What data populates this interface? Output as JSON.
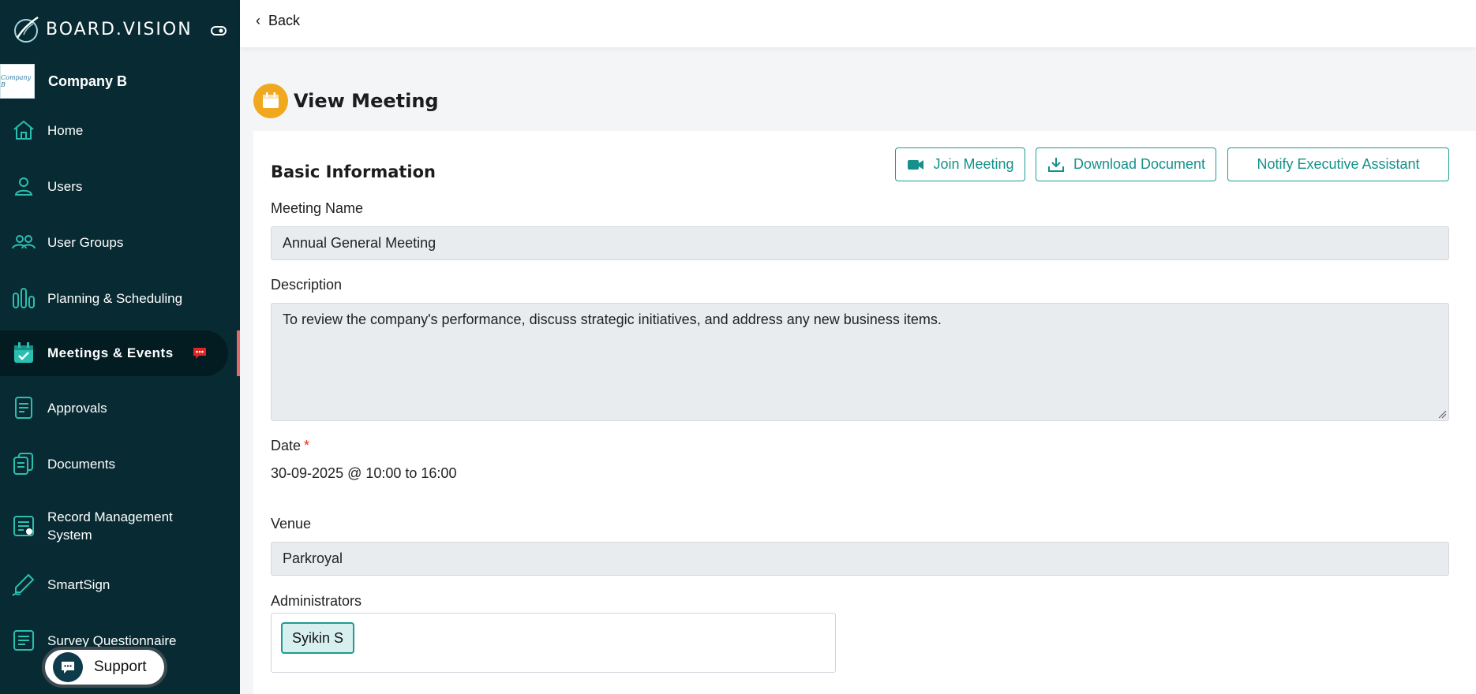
{
  "brand": {
    "name": "BOARD.VISION"
  },
  "company": {
    "name": "Company B",
    "logo_text": "Company B"
  },
  "sidebar": {
    "items": [
      {
        "label": "Home",
        "icon": "home-icon"
      },
      {
        "label": "Users",
        "icon": "user-icon"
      },
      {
        "label": "User Groups",
        "icon": "user-group-icon"
      },
      {
        "label": "Planning & Scheduling",
        "icon": "bar-chart-icon"
      },
      {
        "label": "Meetings & Events",
        "icon": "calendar-check-icon",
        "active": true
      },
      {
        "label": "Approvals",
        "icon": "approval-doc-icon"
      },
      {
        "label": "Documents",
        "icon": "documents-icon"
      },
      {
        "label": "Record Management System",
        "icon": "record-icon"
      },
      {
        "label": "SmartSign",
        "icon": "pen-icon"
      },
      {
        "label": "Survey Questionnaire",
        "icon": "survey-icon"
      }
    ]
  },
  "support": {
    "label": "Support"
  },
  "topbar": {
    "back_label": "Back"
  },
  "page": {
    "title": "View Meeting"
  },
  "section": {
    "title": "Basic Information"
  },
  "actions": {
    "join": "Join Meeting",
    "download": "Download Document",
    "notify": "Notify Executive Assistant"
  },
  "form": {
    "meeting_name_label": "Meeting Name",
    "meeting_name": "Annual General Meeting",
    "description_label": "Description",
    "description": "To review the company's performance, discuss strategic initiatives, and address any new business items.",
    "date_label": "Date",
    "date_required": "*",
    "date_value": "30-09-2025 @ 10:00 to 16:00",
    "venue_label": "Venue",
    "venue": "Parkroyal",
    "administrators_label": "Administrators",
    "administrators": [
      "Syikin S"
    ]
  },
  "colors": {
    "sidebar_bg": "#082a33",
    "accent": "#1c9c92",
    "active_marker": "#e46a6a",
    "title_icon_bg": "#f0a81e"
  }
}
